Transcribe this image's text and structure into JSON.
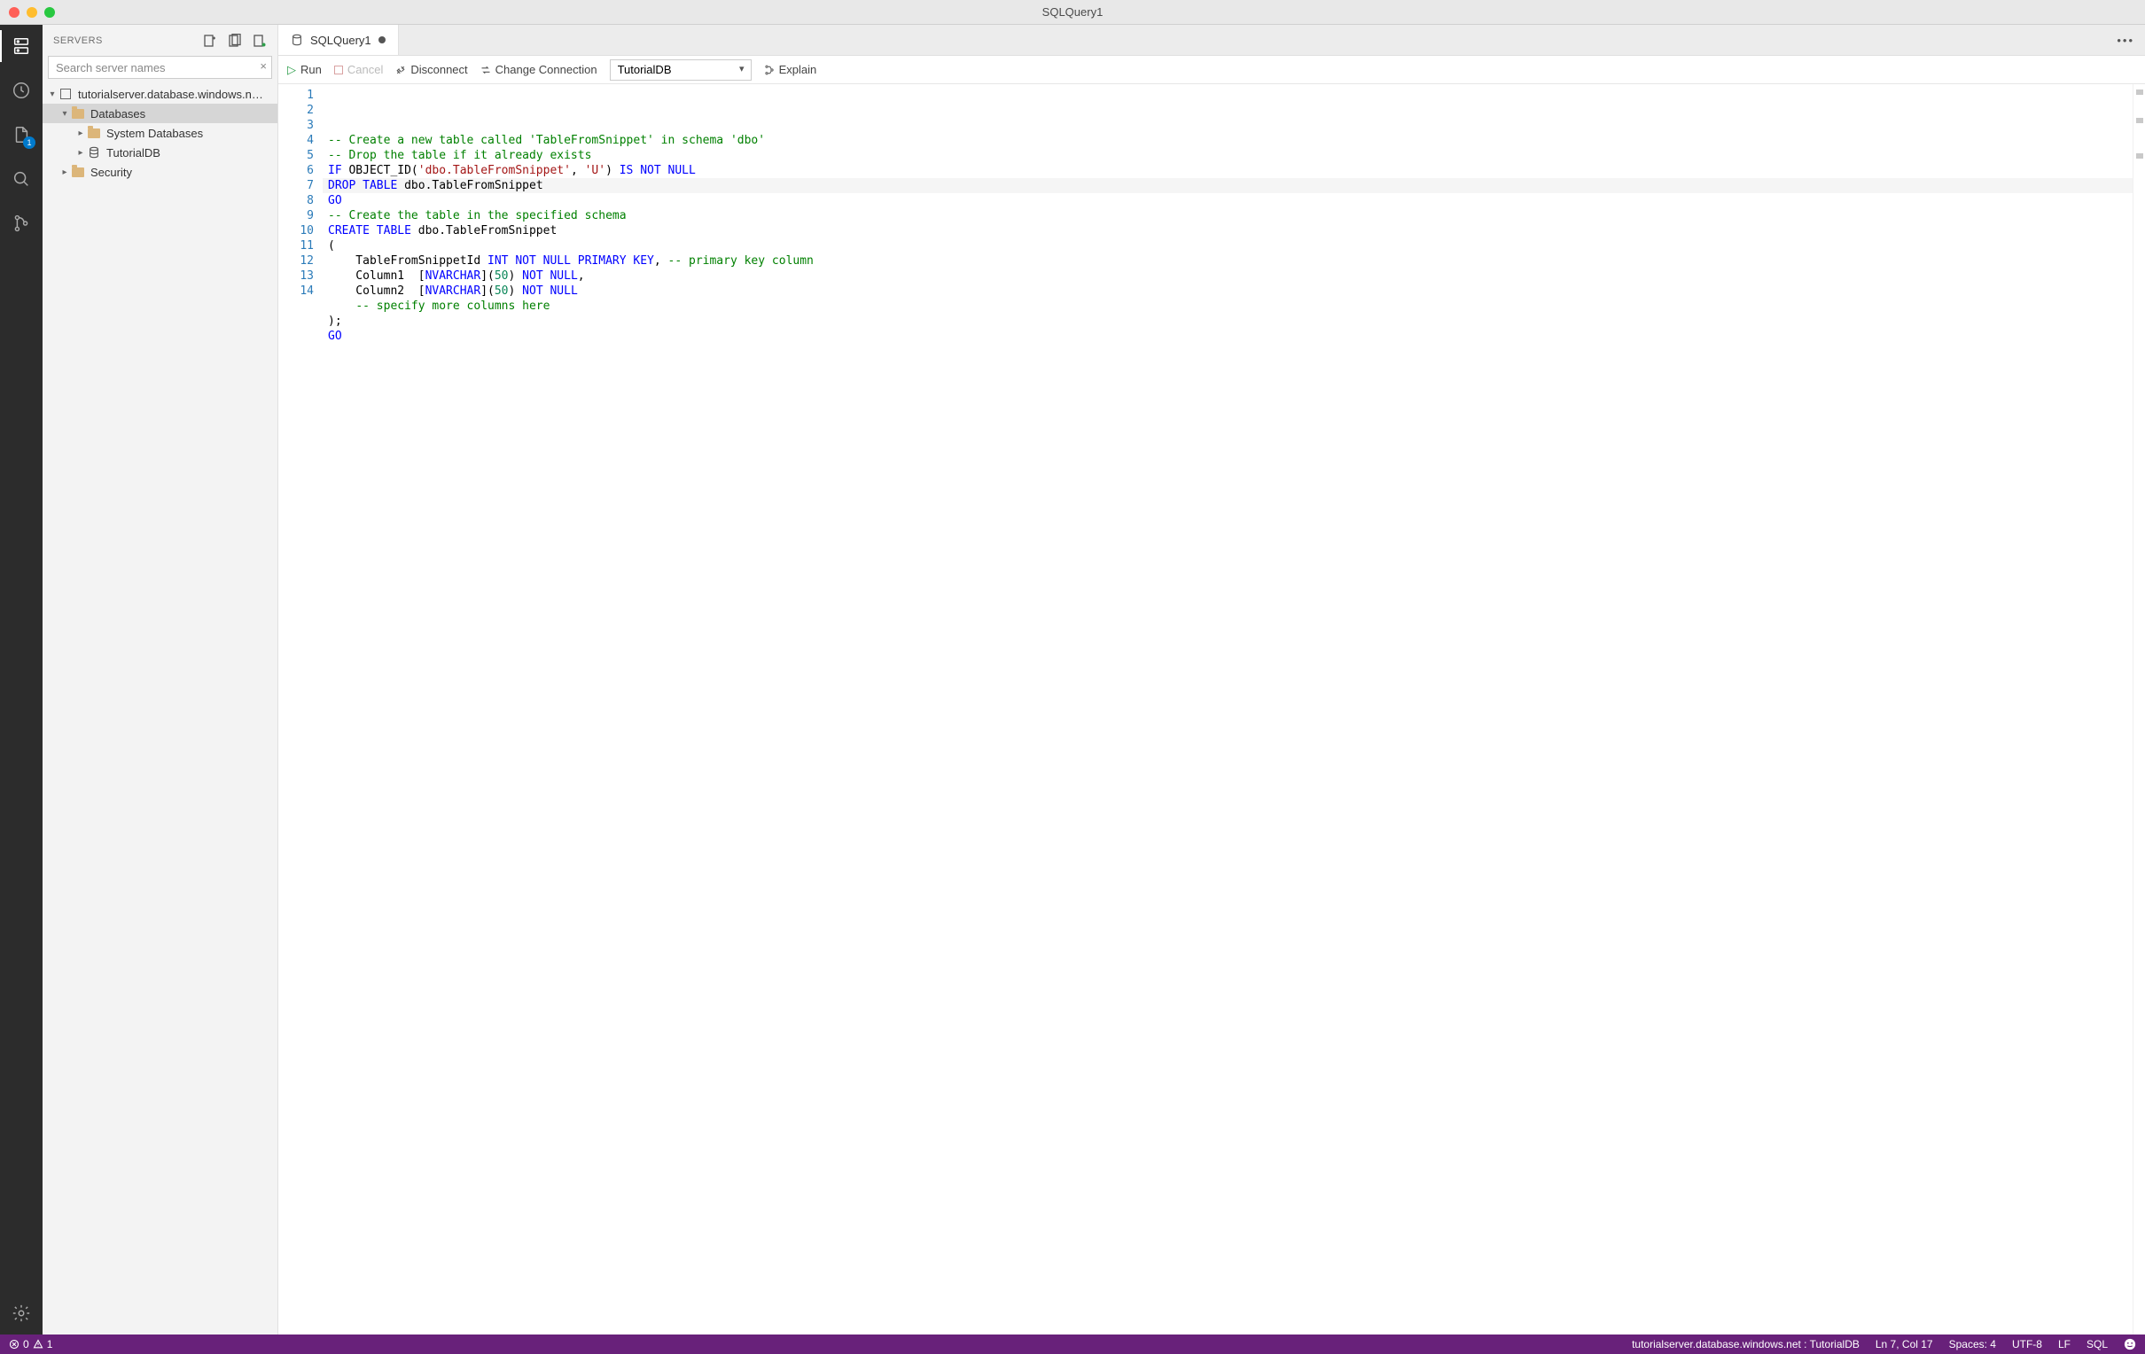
{
  "window": {
    "title": "SQLQuery1"
  },
  "activity": {
    "task_badge": "1"
  },
  "sidebar": {
    "header": "Servers",
    "search_placeholder": "Search server names",
    "server_name": "tutorialserver.database.windows.n…",
    "nodes": {
      "databases": "Databases",
      "system_databases": "System Databases",
      "tutorialdb": "TutorialDB",
      "security": "Security"
    }
  },
  "tabs": {
    "active": "SQLQuery1"
  },
  "toolbar": {
    "run": "Run",
    "cancel": "Cancel",
    "disconnect": "Disconnect",
    "change_connection": "Change Connection",
    "explain": "Explain",
    "connection_selected": "TutorialDB"
  },
  "editor": {
    "line_numbers": [
      "1",
      "2",
      "3",
      "4",
      "5",
      "6",
      "7",
      "8",
      "9",
      "10",
      "11",
      "12",
      "13",
      "14"
    ],
    "code_lines": [
      {
        "type": "comment",
        "text": "-- Create a new table called 'TableFromSnippet' in schema 'dbo'"
      },
      {
        "type": "comment",
        "text": "-- Drop the table if it already exists"
      },
      {
        "type": "mixed",
        "tokens": [
          [
            "kw",
            "IF"
          ],
          [
            "ident",
            " OBJECT_ID("
          ],
          [
            "str",
            "'dbo.TableFromSnippet'"
          ],
          [
            "ident",
            ", "
          ],
          [
            "str",
            "'U'"
          ],
          [
            "ident",
            ") "
          ],
          [
            "kw",
            "IS NOT NULL"
          ]
        ]
      },
      {
        "type": "mixed",
        "tokens": [
          [
            "kw",
            "DROP TABLE"
          ],
          [
            "ident",
            " dbo.TableFromSnippet"
          ]
        ]
      },
      {
        "type": "kw",
        "text": "GO"
      },
      {
        "type": "comment",
        "text": "-- Create the table in the specified schema"
      },
      {
        "type": "mixed",
        "tokens": [
          [
            "kw",
            "CREATE TABLE"
          ],
          [
            "ident",
            " dbo.TableFromSnippet"
          ]
        ]
      },
      {
        "type": "ident",
        "text": "("
      },
      {
        "type": "mixed",
        "tokens": [
          [
            "ident",
            "    TableFromSnippetId "
          ],
          [
            "kw",
            "INT NOT NULL PRIMARY KEY"
          ],
          [
            "ident",
            ", "
          ],
          [
            "comment",
            "-- primary key column"
          ]
        ]
      },
      {
        "type": "mixed",
        "tokens": [
          [
            "ident",
            "    Column1  ["
          ],
          [
            "type",
            "NVARCHAR"
          ],
          [
            "ident",
            "]("
          ],
          [
            "num",
            "50"
          ],
          [
            "ident",
            ") "
          ],
          [
            "kw",
            "NOT NULL"
          ],
          [
            "ident",
            ","
          ]
        ]
      },
      {
        "type": "mixed",
        "tokens": [
          [
            "ident",
            "    Column2  ["
          ],
          [
            "type",
            "NVARCHAR"
          ],
          [
            "ident",
            "]("
          ],
          [
            "num",
            "50"
          ],
          [
            "ident",
            ") "
          ],
          [
            "kw",
            "NOT NULL"
          ]
        ]
      },
      {
        "type": "mixed",
        "tokens": [
          [
            "ident",
            "    "
          ],
          [
            "comment",
            "-- specify more columns here"
          ]
        ]
      },
      {
        "type": "ident",
        "text": ");"
      },
      {
        "type": "kw",
        "text": "GO"
      }
    ]
  },
  "statusbar": {
    "errors": "0",
    "warnings": "1",
    "connection": "tutorialserver.database.windows.net : TutorialDB",
    "position": "Ln 7, Col 17",
    "spaces": "Spaces: 4",
    "encoding": "UTF-8",
    "eol": "LF",
    "language": "SQL"
  }
}
